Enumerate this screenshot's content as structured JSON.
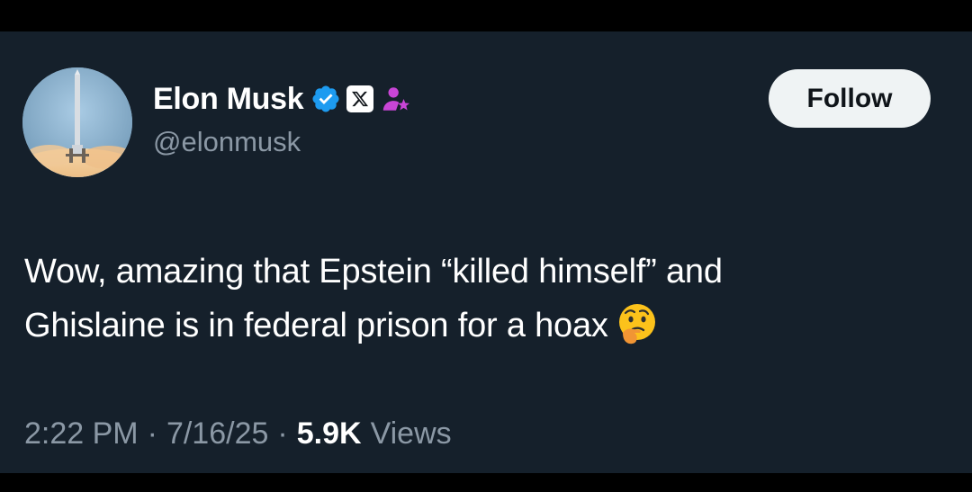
{
  "author": {
    "display_name": "Elon Musk",
    "handle": "@elonmusk",
    "avatar_icon": "rocket-launch-avatar",
    "badges": [
      "verified-check-icon",
      "x-logo-icon",
      "affiliate-person-icon"
    ]
  },
  "follow_button": {
    "label": "Follow"
  },
  "tweet": {
    "line1": "Wow, amazing that Epstein “killed himself” and",
    "line2": "Ghislaine is in federal prison for a hoax",
    "emoji": "thinking-face-emoji"
  },
  "meta": {
    "time": "2:22 PM",
    "separator": "·",
    "date": "7/16/25",
    "views_count": "5.9K",
    "views_label": "Views"
  },
  "colors": {
    "background": "#15202b",
    "verified_blue": "#1d9bf0",
    "affiliate_purple": "#c845d6",
    "secondary_text": "#8b98a5"
  }
}
